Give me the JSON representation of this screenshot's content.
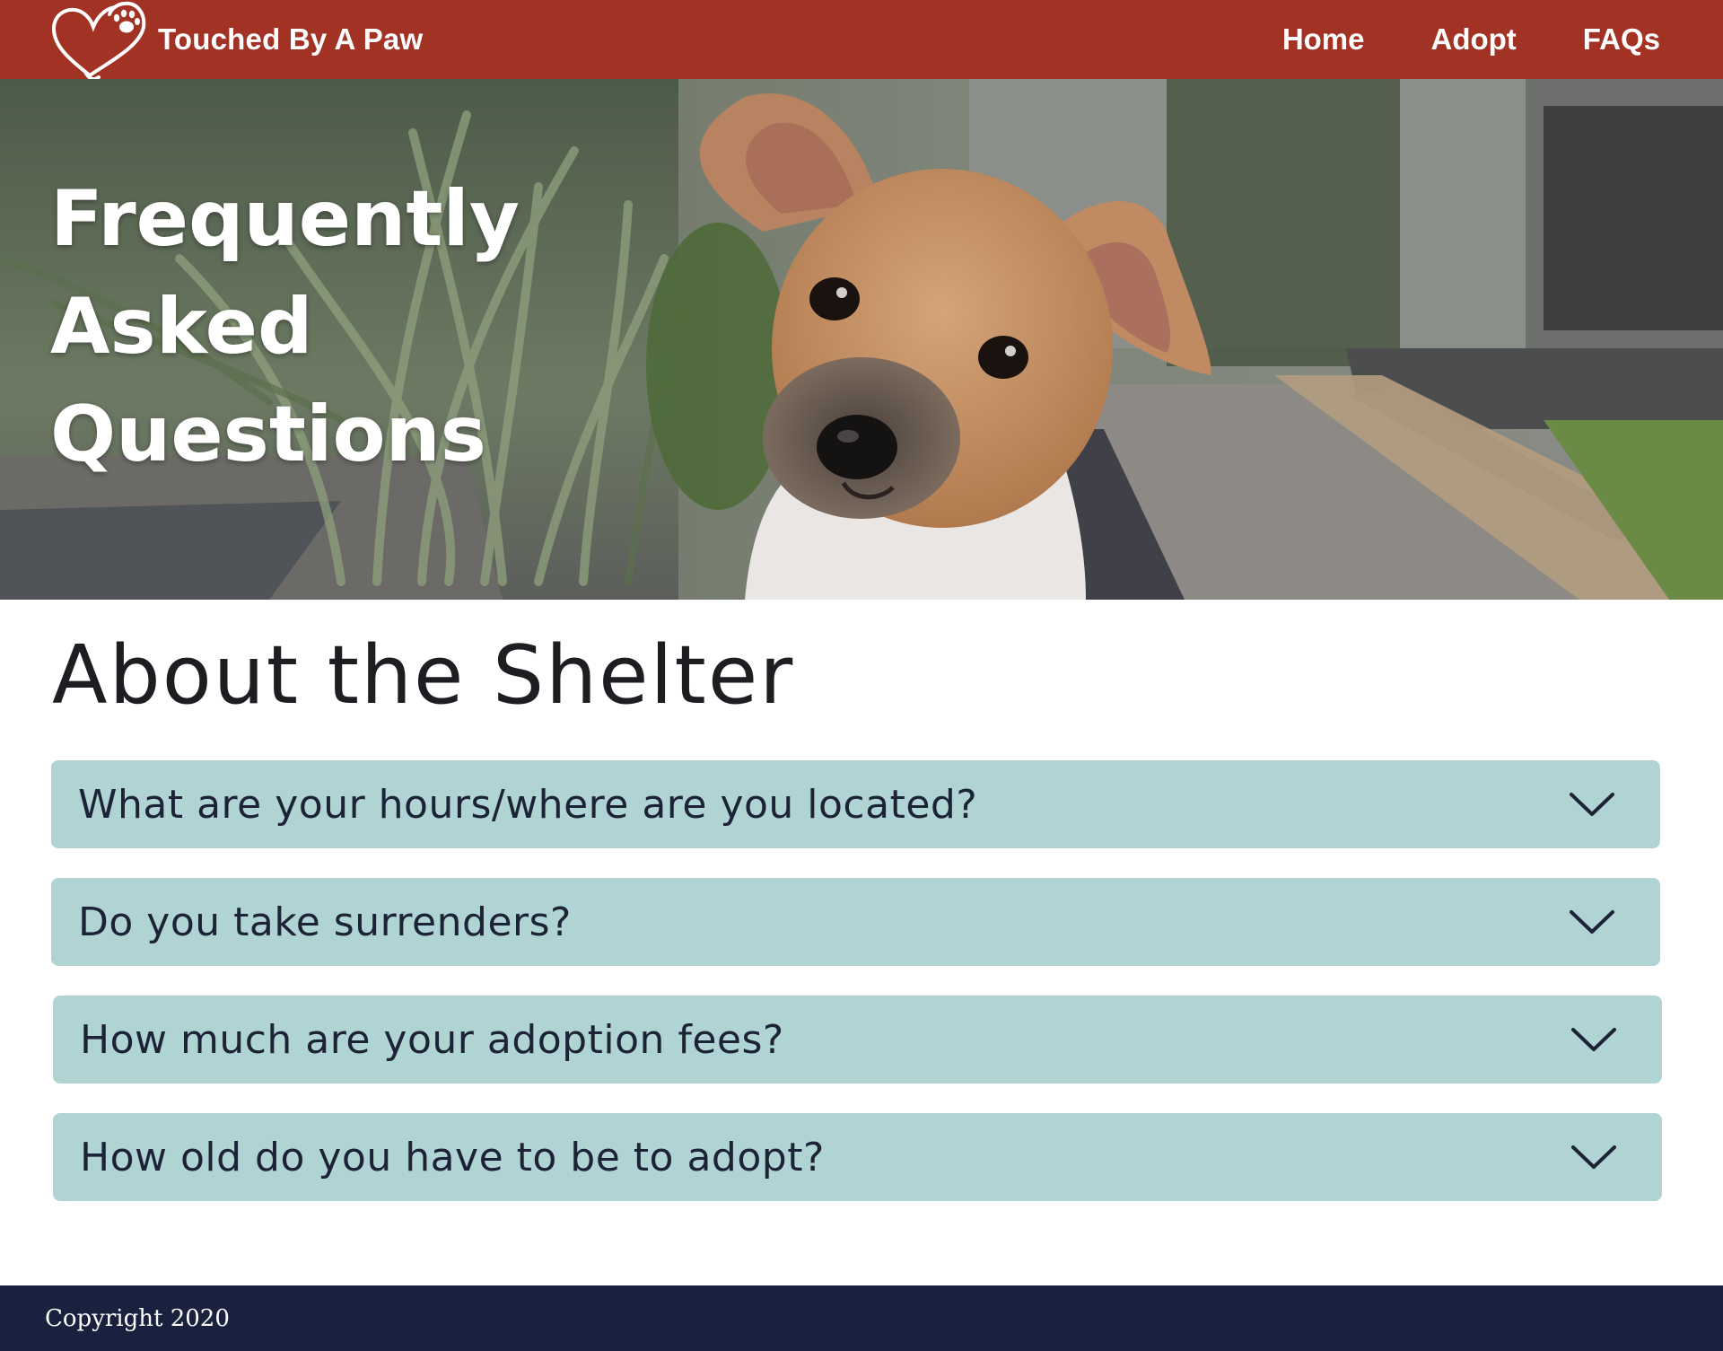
{
  "header": {
    "brand_name": "Touched By A Paw",
    "brand_color": "#a23224",
    "logo_icon": "heart-paw-icon",
    "nav": [
      {
        "label": "Home"
      },
      {
        "label": "Adopt"
      },
      {
        "label": "FAQs"
      }
    ]
  },
  "hero": {
    "title_lines": [
      "Frequently",
      "Asked",
      "Questions"
    ],
    "image": "puppy-photo"
  },
  "main": {
    "section_title": "About the Shelter",
    "accordion_color": "#b0d4d3",
    "questions": [
      {
        "text": "What are your hours/where are you located?",
        "icon": "chevron-down-icon"
      },
      {
        "text": "Do you take surrenders?",
        "icon": "chevron-down-icon"
      },
      {
        "text": "How much are your adoption fees?",
        "icon": "chevron-down-icon"
      },
      {
        "text": "How old do you have to be to adopt?",
        "icon": "chevron-down-icon"
      }
    ]
  },
  "footer": {
    "copyright": "Copyright 2020",
    "color": "#18213d"
  }
}
